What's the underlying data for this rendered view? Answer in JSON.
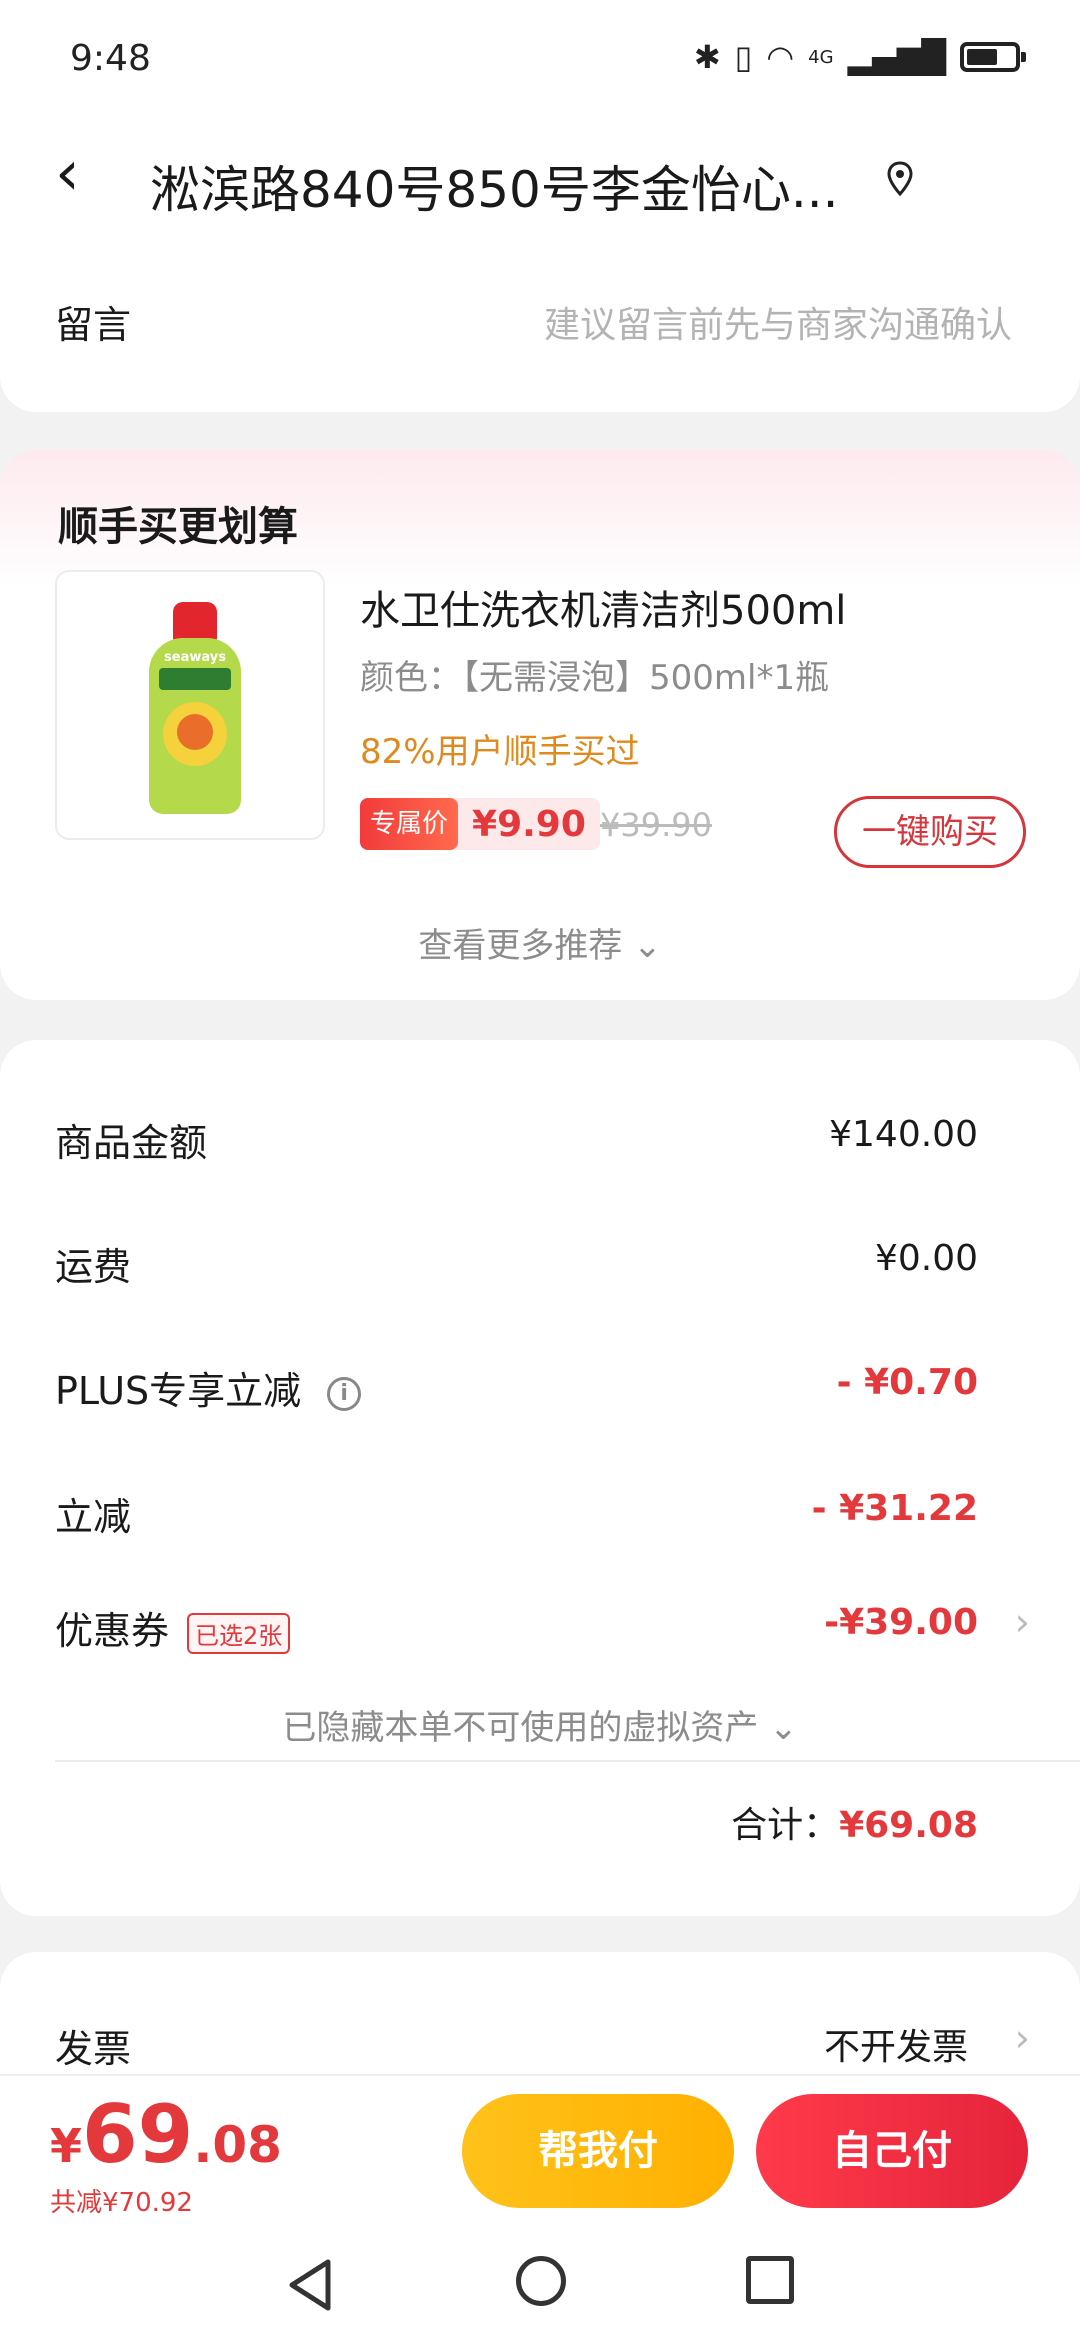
{
  "status_bar": {
    "time": "9:48",
    "network": "4G"
  },
  "header": {
    "address": "淞滨路840号850号李金怡心..."
  },
  "message": {
    "label": "留言",
    "placeholder": "建议留言前先与商家沟通确认"
  },
  "recommend": {
    "title": "顺手买更划算",
    "product": {
      "name": "水卫仕洗衣机清洁剂500ml",
      "spec": "颜色：【无需浸泡】500ml*1瓶",
      "hint": "82%用户顺手买过",
      "tag": "专属价",
      "price": "¥9.90",
      "original_price": "¥39.90",
      "buy_label": "一键购买",
      "image_brand": "seaways"
    },
    "more_label": "查看更多推荐"
  },
  "cost": {
    "rows": [
      {
        "label": "商品金额",
        "value": "¥140.00"
      },
      {
        "label": "运费",
        "value": "¥0.00"
      },
      {
        "label": "PLUS专享立减",
        "value": "- ¥0.70"
      },
      {
        "label": "立减",
        "value": "- ¥31.22"
      },
      {
        "label": "优惠券",
        "tag": "已选2张",
        "value": "-¥39.00"
      }
    ],
    "hidden_assets": "已隐藏本单不可使用的虚拟资产",
    "total_label": "合计：",
    "total_value": "¥69.08"
  },
  "invoice": {
    "label": "发票",
    "value": "不开发票"
  },
  "bottom": {
    "currency": "¥",
    "amount_int": "69",
    "amount_dec": ".08",
    "saved": "共减¥70.92",
    "help_pay": "帮我付",
    "self_pay": "自己付"
  },
  "colors": {
    "accent": "#e4393c",
    "help": "#ffb000",
    "hint": "#e08a1e"
  }
}
